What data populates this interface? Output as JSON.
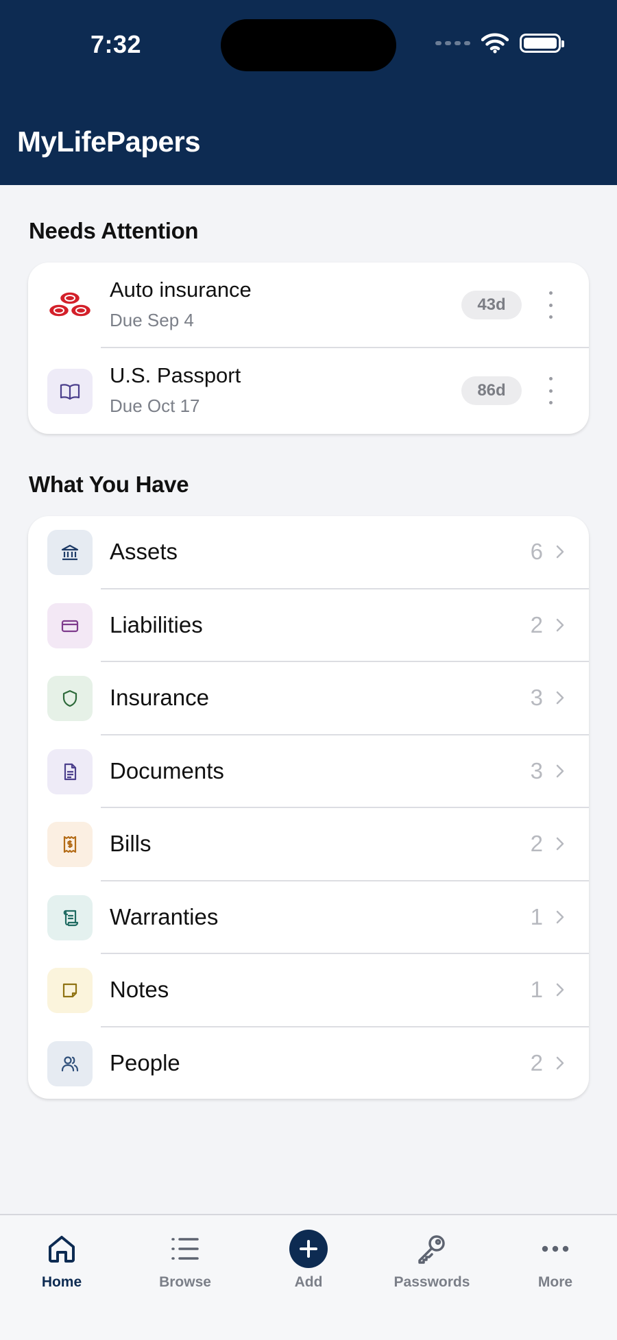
{
  "status_bar": {
    "time": "7:32"
  },
  "app": {
    "title": "MyLifePapers"
  },
  "colors": {
    "header_bg": "#0d2b52",
    "accent": "#0d2b52",
    "background": "#f3f4f7"
  },
  "needs_attention": {
    "title": "Needs Attention",
    "items": [
      {
        "title": "Auto insurance",
        "due": "Due Sep 4",
        "badge": "43d",
        "icon": "insurer-logo-icon"
      },
      {
        "title": "U.S. Passport",
        "due": "Due Oct 17",
        "badge": "86d",
        "icon": "book-icon"
      }
    ]
  },
  "what_you_have": {
    "title": "What You Have",
    "items": [
      {
        "label": "Assets",
        "count": "6",
        "icon": "bank-icon"
      },
      {
        "label": "Liabilities",
        "count": "2",
        "icon": "credit-card-icon"
      },
      {
        "label": "Insurance",
        "count": "3",
        "icon": "shield-icon"
      },
      {
        "label": "Documents",
        "count": "3",
        "icon": "document-icon"
      },
      {
        "label": "Bills",
        "count": "2",
        "icon": "receipt-icon"
      },
      {
        "label": "Warranties",
        "count": "1",
        "icon": "scroll-icon"
      },
      {
        "label": "Notes",
        "count": "1",
        "icon": "note-icon"
      },
      {
        "label": "People",
        "count": "2",
        "icon": "people-icon"
      }
    ]
  },
  "tabbar": {
    "tabs": [
      {
        "label": "Home",
        "icon": "home-icon",
        "active": true
      },
      {
        "label": "Browse",
        "icon": "list-icon"
      },
      {
        "label": "Add",
        "icon": "plus-circle-icon"
      },
      {
        "label": "Passwords",
        "icon": "key-icon"
      },
      {
        "label": "More",
        "icon": "ellipsis-icon"
      }
    ]
  }
}
